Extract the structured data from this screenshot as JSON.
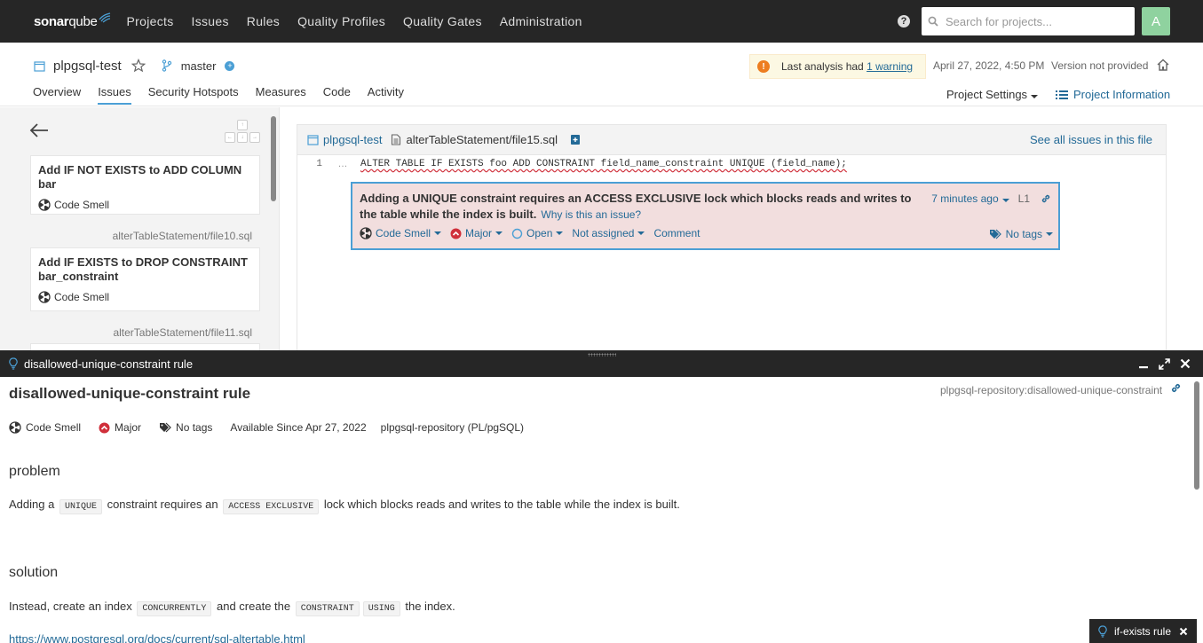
{
  "topnav": {
    "logo_part1": "sonar",
    "logo_part2": "qube",
    "items": [
      "Projects",
      "Issues",
      "Rules",
      "Quality Profiles",
      "Quality Gates",
      "Administration"
    ],
    "search_placeholder": "Search for projects...",
    "avatar_letter": "A"
  },
  "project": {
    "name": "plpgsql-test",
    "branch": "master",
    "warning_prefix": "Last analysis had ",
    "warning_link": "1 warning",
    "analysis_date": "April 27, 2022, 4:50 PM",
    "version": "Version not provided",
    "tabs": [
      "Overview",
      "Issues",
      "Security Hotspots",
      "Measures",
      "Code",
      "Activity"
    ],
    "active_tab": "Issues",
    "settings_label": "Project Settings",
    "info_label": "Project Information"
  },
  "sidebar": {
    "keys": [
      "↑",
      "←",
      "↓",
      "→"
    ],
    "issues": [
      {
        "title": "Add IF NOT EXISTS to ADD COLUMN bar",
        "type": "Code Smell"
      },
      {
        "file": "alterTableStatement/file10.sql",
        "title": "Add IF EXISTS to DROP CONSTRAINT bar_constraint",
        "type": "Code Smell"
      },
      {
        "file": "alterTableStatement/file11.sql"
      }
    ]
  },
  "viewer": {
    "project": "plpgsql-test",
    "file": "alterTableStatement/file15.sql",
    "see_all": "See all issues in this file",
    "line_number": "1",
    "line_dots": "…",
    "code": "ALTER TABLE IF EXISTS foo ADD CONSTRAINT field_name_constraint UNIQUE (field_name);",
    "issue": {
      "message": "Adding a UNIQUE constraint requires an ACCESS EXCLUSIVE lock which blocks reads and writes to the table while the index is built.",
      "why_link": "Why is this an issue?",
      "age": "7 minutes ago",
      "line": "L1",
      "type": "Code Smell",
      "severity": "Major",
      "status": "Open",
      "assignee": "Not assigned",
      "comment": "Comment",
      "tags": "No tags"
    }
  },
  "workspace": {
    "bar_title": "disallowed-unique-constraint rule",
    "rule_title": "disallowed-unique-constraint rule",
    "rule_key": "plpgsql-repository:disallowed-unique-constraint",
    "meta": {
      "type": "Code Smell",
      "severity": "Major",
      "tags": "No tags",
      "available_since": "Available Since Apr 27, 2022",
      "repository": "plpgsql-repository (PL/pgSQL)"
    },
    "problem_heading": "problem",
    "problem": {
      "t1": "Adding a ",
      "c1": "UNIQUE",
      "t2": " constraint requires an ",
      "c2": "ACCESS EXCLUSIVE",
      "t3": " lock which blocks reads and writes to the table while the index is built."
    },
    "solution_heading": "solution",
    "solution": {
      "t1": "Instead, create an index ",
      "c1": "CONCURRENTLY",
      "t2": " and create the ",
      "c2": "CONSTRAINT",
      "c3": "USING",
      "t3": " the index."
    },
    "doc_link": "https://www.postgresql.org/docs/current/sql-altertable.html",
    "minimized_tab": "if-exists rule"
  },
  "colors": {
    "nav_bg": "#262626",
    "link": "#236a97",
    "accent": "#4b9fd5",
    "issue_bg": "#f2dede",
    "major": "#d02f3a",
    "warning": "#ed7d20"
  }
}
